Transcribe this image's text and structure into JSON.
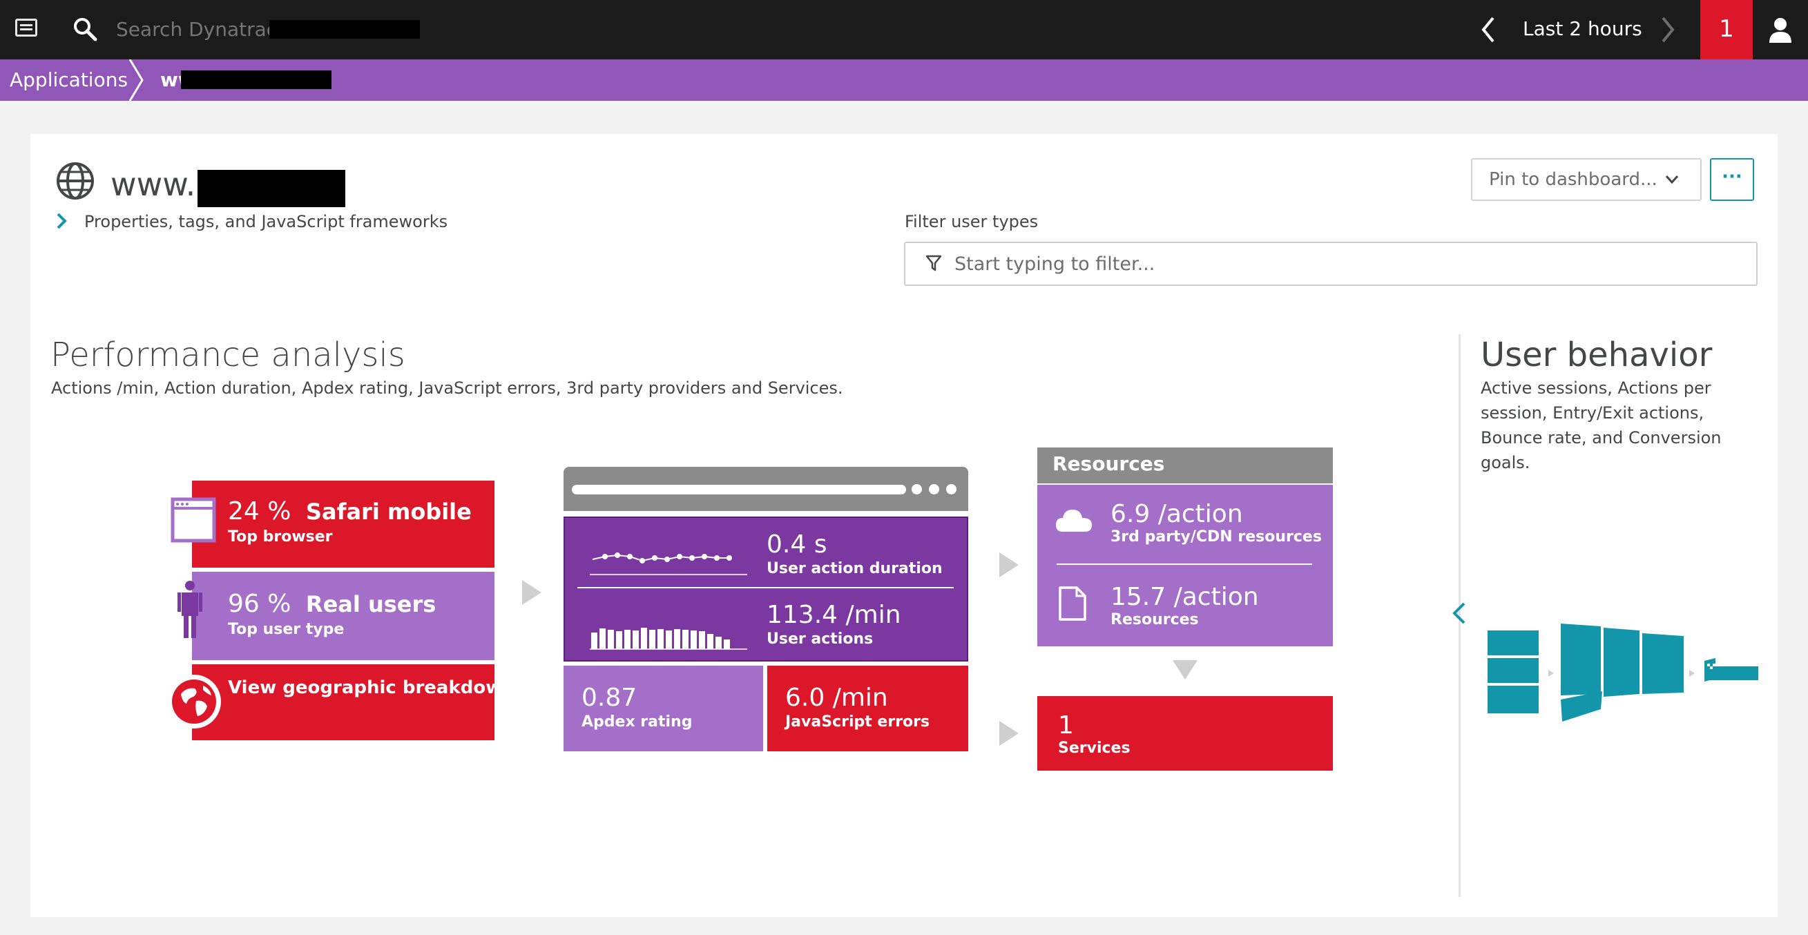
{
  "topbar": {
    "menu_icon": "menu-icon",
    "search_placeholder": "Search Dynatrace",
    "timeframe": "Last 2 hours",
    "problems_count": "1",
    "user_icon": "user-icon"
  },
  "breadcrumb": {
    "applications": "Applications",
    "application": "ww                    m"
  },
  "header": {
    "title": "www.                  com",
    "properties_link": "Properties, tags, and JavaScript frameworks",
    "pin_label": "Pin to dashboard...",
    "more_label": "···",
    "filter_label": "Filter user types",
    "filter_placeholder": "Start typing to filter..."
  },
  "performance": {
    "title": "Performance analysis",
    "subtitle": "Actions /min, Action duration, Apdex rating, JavaScript errors, 3rd party providers and Services.",
    "browser_value": "24 %",
    "browser_name": "Safari mobile",
    "browser_label": "Top browser",
    "users_value": "96 %",
    "users_name": "Real users",
    "users_label": "Top user type",
    "geo_label": "View geographic breakdown",
    "duration_value": "0.4 s",
    "duration_label": "User action duration",
    "actions_value": "113.4 /min",
    "actions_label": "User actions",
    "apdex_value": "0.87",
    "apdex_label": "Apdex rating",
    "jserr_value": "6.0 /min",
    "jserr_label": "JavaScript errors",
    "resources_title": "Resources",
    "third_party_value": "6.9 /action",
    "third_party_label": "3rd party/CDN resources",
    "resources_value": "15.7 /action",
    "resources_label": "Resources",
    "services_value": "1",
    "services_label": "Services"
  },
  "user_behavior": {
    "title": "User behavior",
    "subtitle": "Active sessions, Actions per session, Entry/Exit actions, Bounce rate, and Conversion goals."
  },
  "colors": {
    "topbar": "#1b1b1b",
    "breadcrumb": "#9157b8",
    "red": "#dc172a",
    "purple": "#a36fc9",
    "dark_purple": "#7c38a1",
    "teal": "#1496aa",
    "gray": "#8b8b8b"
  }
}
